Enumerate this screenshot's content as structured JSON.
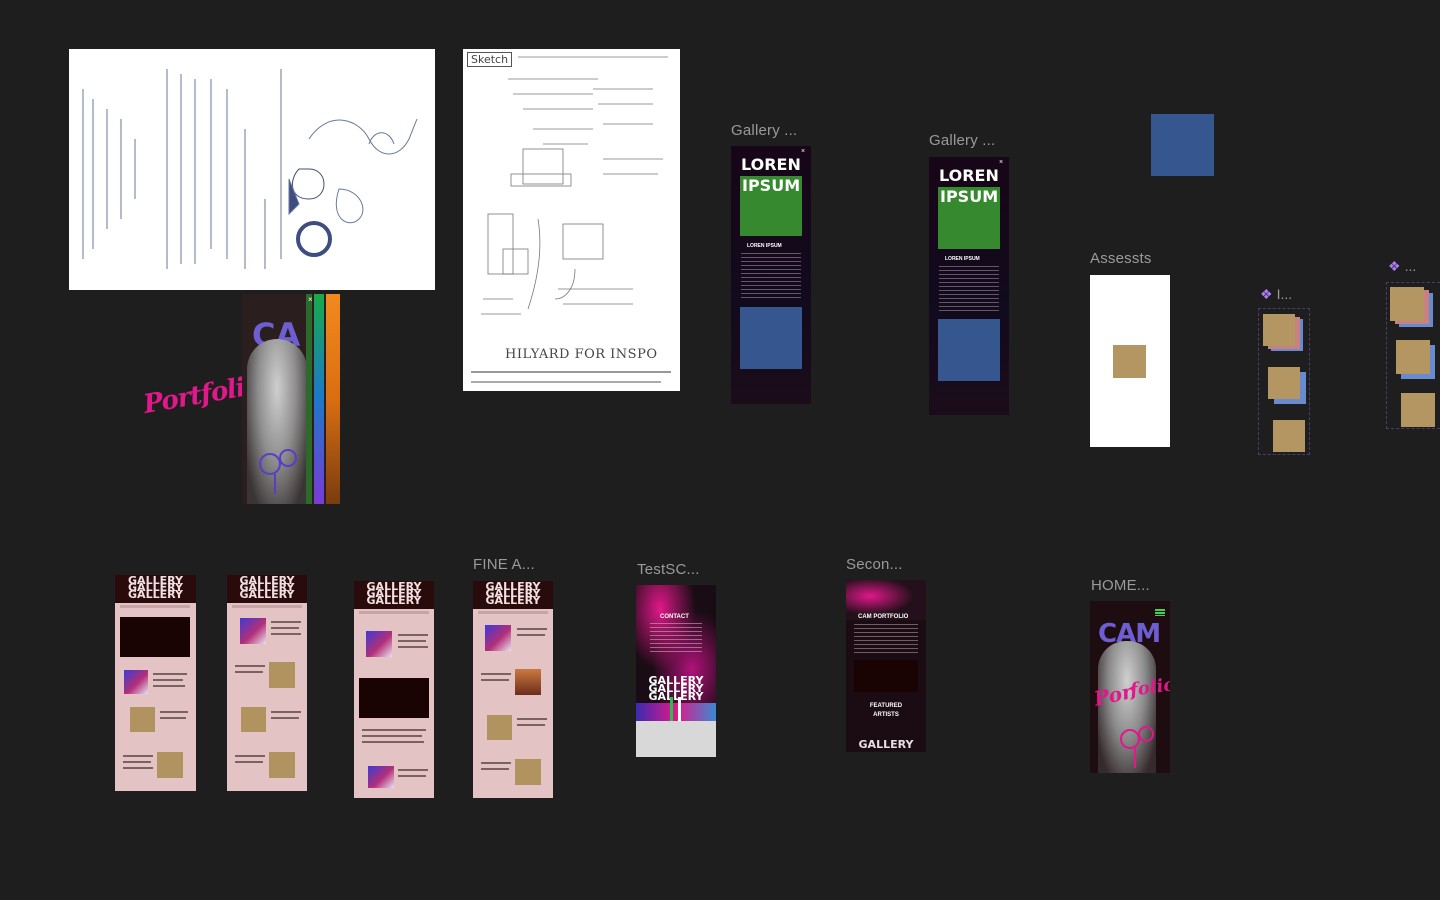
{
  "canvas": {
    "background": "#1e1e1e"
  },
  "frames": {
    "gallery_1": {
      "label": "Gallery ...",
      "title_line1": "LOREN",
      "title_line2": "IPSUM",
      "subtitle": "LOREN IPSUM"
    },
    "gallery_2": {
      "label": "Gallery ...",
      "title_line1": "LOREN",
      "title_line2": "IPSUM",
      "subtitle": "LOREN IPSUM"
    },
    "assets": {
      "label": "Assessts"
    },
    "fine_art": {
      "label": "FINE A..."
    },
    "test": {
      "label": "TestSC...",
      "contact": "CONTACT"
    },
    "second": {
      "label": "Secon...",
      "portfolio": "CAM PORTFOLIO",
      "featured": "FEATURED ARTISTS"
    },
    "home": {
      "label": "HOME..."
    }
  },
  "components": {
    "comp_1": {
      "label": "I..."
    },
    "comp_2": {
      "label": "..."
    }
  },
  "sketch": {
    "tag": "Sketch",
    "note": "HILYARD FOR INSPO",
    "portfolio_word": "Portfolio"
  },
  "gallery_word": "GALLERY",
  "colors": {
    "green": "#36892f",
    "blue": "#35568f",
    "tan": "#b39661",
    "pink": "#e3c3c4",
    "magenta": "#e0188a",
    "purple": "#b07cf6"
  }
}
